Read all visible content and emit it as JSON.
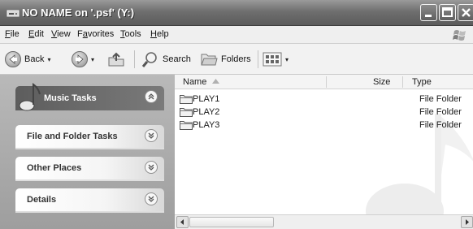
{
  "window": {
    "title": "NO NAME on '.psf' (Y:)",
    "controls": {
      "minimize": "minimize-icon",
      "maximize": "maximize-icon",
      "close": "close-icon"
    }
  },
  "menubar": {
    "items": [
      {
        "label": "File",
        "accel": "F",
        "rest": "ile"
      },
      {
        "label": "Edit",
        "accel": "E",
        "rest": "dit"
      },
      {
        "label": "View",
        "accel": "V",
        "rest": "iew"
      },
      {
        "label": "Favorites",
        "pre": "F",
        "accel": "a",
        "rest": "vorites"
      },
      {
        "label": "Tools",
        "accel": "T",
        "rest": "ools"
      },
      {
        "label": "Help",
        "accel": "H",
        "rest": "elp"
      }
    ]
  },
  "toolbar": {
    "back_label": "Back",
    "search_label": "Search",
    "folders_label": "Folders"
  },
  "tasks": {
    "music": "Music Tasks",
    "file_folder": "File and Folder Tasks",
    "other_places": "Other Places",
    "details": "Details"
  },
  "list": {
    "headers": {
      "name": "Name",
      "size": "Size",
      "type": "Type"
    },
    "rows": [
      {
        "name": "PLAY1",
        "size": "",
        "type": "File Folder"
      },
      {
        "name": "PLAY2",
        "size": "",
        "type": "File Folder"
      },
      {
        "name": "PLAY3",
        "size": "",
        "type": "File Folder"
      }
    ]
  },
  "colors": {
    "titlebar": "#6f6f6f",
    "leftpane": "#b0b0b0",
    "music_header": "#666666"
  }
}
